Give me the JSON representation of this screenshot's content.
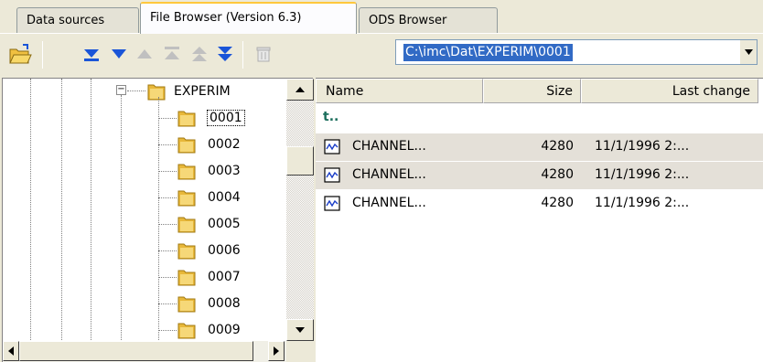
{
  "tabs": {
    "data_sources": "Data sources",
    "file_browser": "File Browser (Version 6.3)",
    "ods_browser": "ODS Browser",
    "active": "file_browser"
  },
  "toolbar": {
    "icons": [
      "open-folder-icon",
      "move-bottom-icon",
      "move-down-icon",
      "move-up-icon",
      "move-top-icon",
      "move-up-page-icon",
      "move-down-page-icon",
      "delete-icon"
    ],
    "path_value": "C:\\imc\\Dat\\EXPERIM\\0001"
  },
  "tree": {
    "parent": {
      "label": "EXPERIM",
      "expander": "−"
    },
    "children": [
      "0001",
      "0002",
      "0003",
      "0004",
      "0005",
      "0006",
      "0007",
      "0008",
      "0009"
    ],
    "selected": "0001"
  },
  "list": {
    "columns": {
      "name": "Name",
      "size": "Size",
      "last_change": "Last change"
    },
    "up_label": "t..",
    "rows": [
      {
        "name": "CHANNEL...",
        "size": "4280",
        "last_change": "11/1/1996 2:...",
        "highlighted": true
      },
      {
        "name": "CHANNEL...",
        "size": "4280",
        "last_change": "11/1/1996 2:...",
        "highlighted": true
      },
      {
        "name": "CHANNEL...",
        "size": "4280",
        "last_change": "11/1/1996 2:...",
        "highlighted": false
      }
    ]
  },
  "colors": {
    "accent": "#316ac5",
    "folder": "#e8b83a",
    "blue_arrow": "#1a55d8",
    "grey_arrow": "#b8b8b8"
  }
}
